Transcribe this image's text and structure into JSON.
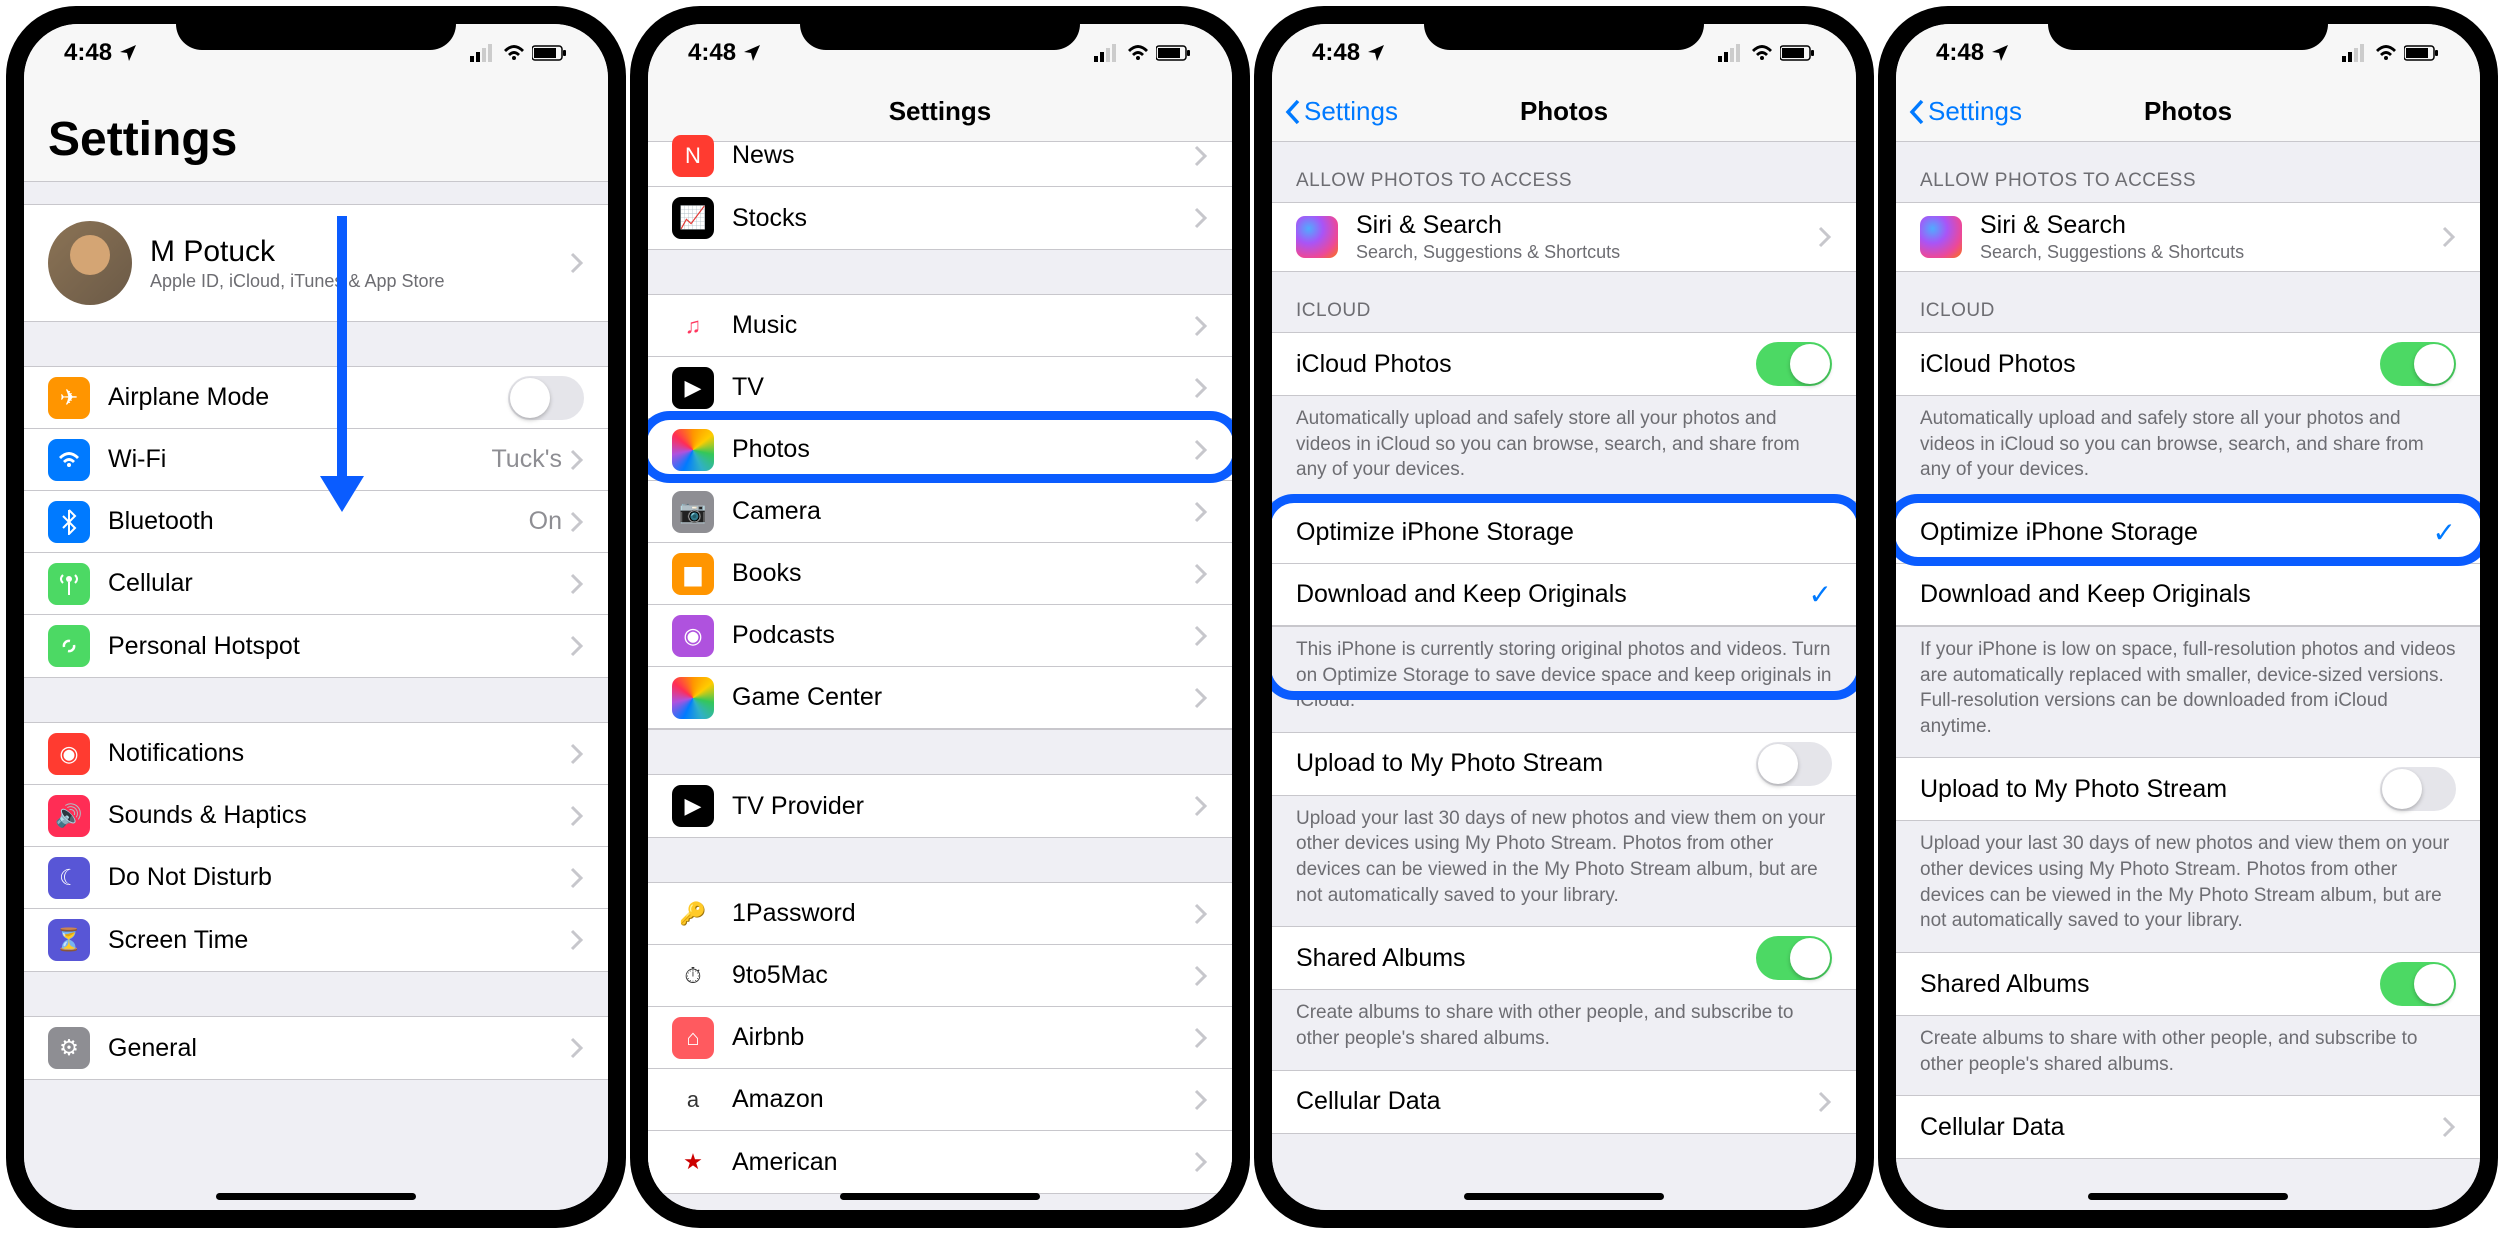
{
  "status": {
    "time": "4:48",
    "loc_icon": true
  },
  "screen1": {
    "title": "Settings",
    "profile": {
      "name": "M Potuck",
      "subtitle": "Apple ID, iCloud, iTunes & App Store"
    },
    "g1": [
      {
        "icon": "✈︎",
        "bg": "#ff9500",
        "label": "Airplane Mode",
        "toggle": "off"
      },
      {
        "icon": "wifi",
        "bg": "#007aff",
        "label": "Wi-Fi",
        "value": "Tuck's"
      },
      {
        "icon": "bt",
        "bg": "#007aff",
        "label": "Bluetooth",
        "value": "On"
      },
      {
        "icon": "ant",
        "bg": "#4cd964",
        "label": "Cellular"
      },
      {
        "icon": "link",
        "bg": "#4cd964",
        "label": "Personal Hotspot"
      }
    ],
    "g2": [
      {
        "icon": "◉",
        "bg": "#ff3b30",
        "label": "Notifications"
      },
      {
        "icon": "🔊",
        "bg": "#ff2d55",
        "label": "Sounds & Haptics"
      },
      {
        "icon": "☾",
        "bg": "#5856d6",
        "label": "Do Not Disturb"
      },
      {
        "icon": "⏳",
        "bg": "#5856d6",
        "label": "Screen Time"
      }
    ],
    "g3": [
      {
        "icon": "⚙",
        "bg": "#8e8e93",
        "label": "General"
      }
    ]
  },
  "screen2": {
    "title": "Settings",
    "rows": [
      {
        "icon": "N",
        "bg": "#ff3b30",
        "label": "News"
      },
      {
        "icon": "📈",
        "bg": "#000",
        "label": "Stocks"
      }
    ],
    "gA": [
      {
        "icon": "♫",
        "bg": "#ffffff",
        "fg": "#ff375f",
        "label": "Music"
      },
      {
        "icon": "▶",
        "bg": "#000",
        "label": "TV"
      },
      {
        "icon": "✿",
        "bg": "#ffffff",
        "multi": true,
        "label": "Photos"
      },
      {
        "icon": "📷",
        "bg": "#8e8e93",
        "label": "Camera"
      },
      {
        "icon": "▆",
        "bg": "#ff9500",
        "label": "Books"
      },
      {
        "icon": "◉",
        "bg": "#af52de",
        "label": "Podcasts"
      },
      {
        "icon": "❋",
        "bg": "#ffffff",
        "multi": true,
        "label": "Game Center"
      }
    ],
    "gB": [
      {
        "icon": "▶",
        "bg": "#000",
        "label": "TV Provider"
      }
    ],
    "gC": [
      {
        "icon": "🔑",
        "bg": "#fff",
        "fg": "#1a5fb4",
        "label": "1Password"
      },
      {
        "icon": "⏱",
        "bg": "#fff",
        "fg": "#333",
        "label": "9to5Mac"
      },
      {
        "icon": "⌂",
        "bg": "#ff5a5f",
        "label": "Airbnb"
      },
      {
        "icon": "a",
        "bg": "#fff",
        "fg": "#333",
        "label": "Amazon"
      },
      {
        "icon": "★",
        "bg": "#fff",
        "fg": "#c00",
        "label": "American"
      }
    ]
  },
  "screen3": {
    "back": "Settings",
    "title": "Photos",
    "sec_allow": "ALLOW PHOTOS TO ACCESS",
    "siri": {
      "title": "Siri & Search",
      "sub": "Search, Suggestions & Shortcuts"
    },
    "sec_icloud": "ICLOUD",
    "icloud_photos": "iCloud Photos",
    "icloud_footer": "Automatically upload and safely store all your photos and videos in iCloud so you can browse, search, and share from any of your devices.",
    "opt": "Optimize iPhone Storage",
    "download": "Download and Keep Originals",
    "download_checked": true,
    "opt_footer": "This iPhone is currently storing original photos and videos. Turn on Optimize Storage to save device space and keep originals in iCloud.",
    "upload": "Upload to My Photo Stream",
    "upload_footer": "Upload your last 30 days of new photos and view them on your other devices using My Photo Stream. Photos from other devices can be viewed in the My Photo Stream album, but are not automatically saved to your library.",
    "shared": "Shared Albums",
    "shared_footer": "Create albums to share with other people, and subscribe to other people's shared albums.",
    "cellular": "Cellular Data"
  },
  "screen4": {
    "back": "Settings",
    "title": "Photos",
    "sec_allow": "ALLOW PHOTOS TO ACCESS",
    "siri": {
      "title": "Siri & Search",
      "sub": "Search, Suggestions & Shortcuts"
    },
    "sec_icloud": "ICLOUD",
    "icloud_photos": "iCloud Photos",
    "icloud_footer": "Automatically upload and safely store all your photos and videos in iCloud so you can browse, search, and share from any of your devices.",
    "opt": "Optimize iPhone Storage",
    "opt_checked": true,
    "download": "Download and Keep Originals",
    "opt_footer": "If your iPhone is low on space, full-resolution photos and videos are automatically replaced with smaller, device-sized versions. Full-resolution versions can be downloaded from iCloud anytime.",
    "upload": "Upload to My Photo Stream",
    "upload_footer": "Upload your last 30 days of new photos and view them on your other devices using My Photo Stream. Photos from other devices can be viewed in the My Photo Stream album, but are not automatically saved to your library.",
    "shared": "Shared Albums",
    "shared_footer": "Create albums to share with other people, and subscribe to other people's shared albums.",
    "cellular": "Cellular Data"
  }
}
